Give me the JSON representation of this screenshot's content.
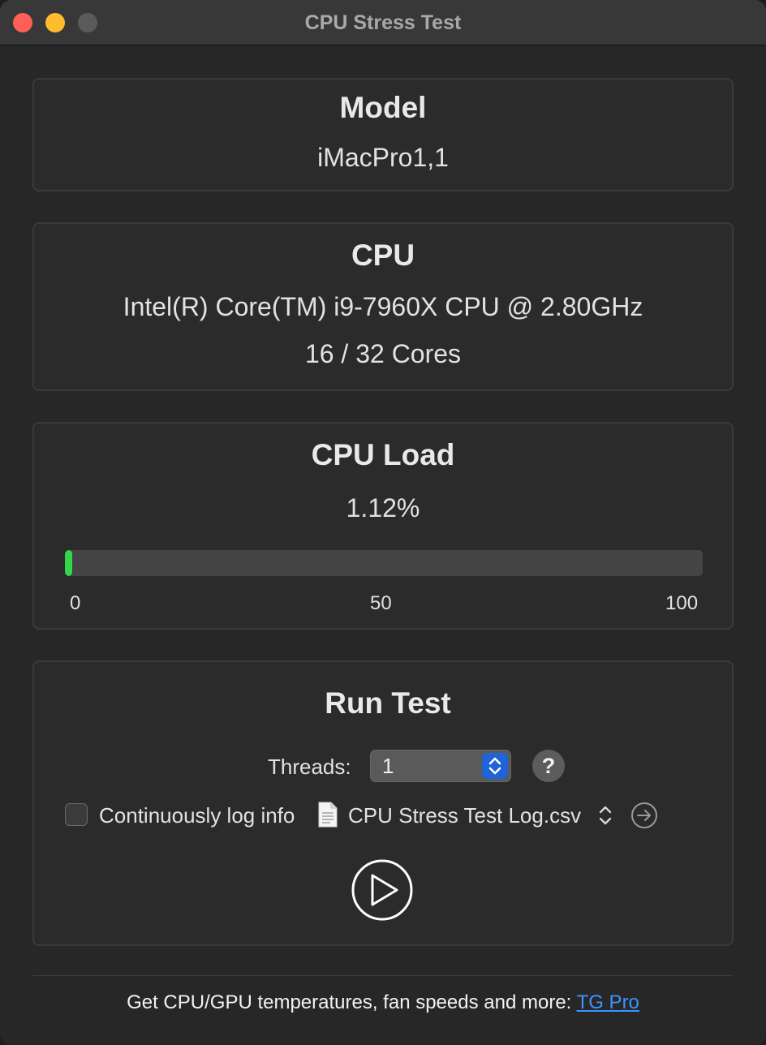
{
  "window": {
    "title": "CPU Stress Test"
  },
  "model": {
    "heading": "Model",
    "value": "iMacPro1,1"
  },
  "cpu": {
    "heading": "CPU",
    "name": "Intel(R) Core(TM) i9-7960X CPU @ 2.80GHz",
    "cores": "16 / 32 Cores"
  },
  "load": {
    "heading": "CPU Load",
    "value_text": "1.12%",
    "value_percent": 1.12,
    "bar_color": "#32d74b",
    "scale": [
      "0",
      "50",
      "100"
    ]
  },
  "run_test": {
    "heading": "Run Test",
    "threads_label": "Threads:",
    "threads_value": "1",
    "help_label": "?",
    "log_label": "Continuously log info",
    "log_checked": false,
    "log_file": "CPU Stress Test Log.csv",
    "accent_color": "#1f64d6"
  },
  "footer": {
    "text": "Get CPU/GPU temperatures, fan speeds and more:",
    "link": "TG Pro",
    "link_color": "#3a94ff"
  }
}
